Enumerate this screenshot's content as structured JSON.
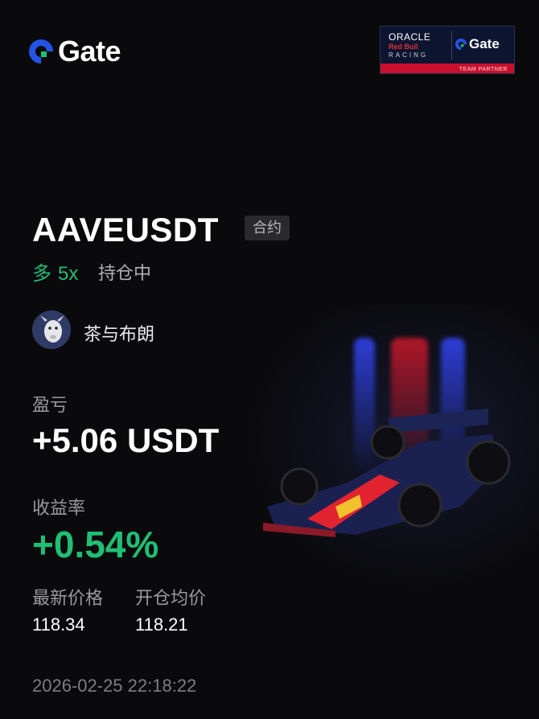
{
  "brand": {
    "logo_text": "Gate"
  },
  "partner": {
    "oracle": "ORACLE",
    "redbull": "Red Bull",
    "racing": "RACING",
    "gate": "Gate",
    "tagline": "TEAM PARTNER"
  },
  "position": {
    "pair": "AAVEUSDT",
    "type_tag": "合约",
    "direction": "多",
    "leverage": "5x",
    "status": "持仓中"
  },
  "user": {
    "name": "茶与布朗"
  },
  "pnl": {
    "label": "盈亏",
    "value": "+5.06 USDT"
  },
  "roi": {
    "label": "收益率",
    "value": "+0.54%"
  },
  "prices": {
    "mark_label": "最新价格",
    "mark_value": "118.34",
    "entry_label": "开仓均价",
    "entry_value": "118.21"
  },
  "timestamp": "2026-02-25 22:18:22",
  "colors": {
    "background": "#0a0a0c",
    "positive": "#1fbf75",
    "muted": "#9a9a9e",
    "brand_blue": "#2354e6"
  }
}
